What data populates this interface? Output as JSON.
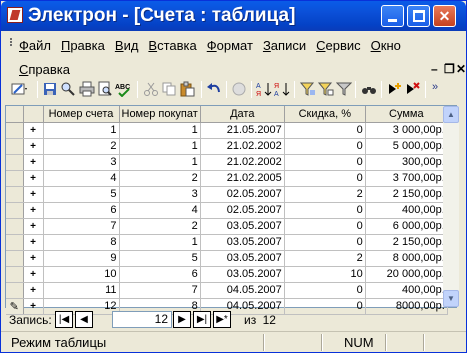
{
  "window": {
    "title": "Электрон - [Счета : таблица]"
  },
  "menu": {
    "items": [
      "Файл",
      "Правка",
      "Вид",
      "Вставка",
      "Формат",
      "Записи",
      "Сервис",
      "Окно"
    ],
    "help": "Справка"
  },
  "table": {
    "columns": [
      "Номер счета",
      "Номер покупат",
      "Дата",
      "Скидка, %",
      "Сумма"
    ],
    "rows": [
      [
        "1",
        "1",
        "21.05.2007",
        "0",
        "3 000,00р."
      ],
      [
        "2",
        "1",
        "21.02.2002",
        "0",
        "5 000,00р."
      ],
      [
        "3",
        "1",
        "21.02.2002",
        "0",
        "300,00р."
      ],
      [
        "4",
        "2",
        "21.02.2005",
        "0",
        "3 700,00р."
      ],
      [
        "5",
        "3",
        "02.05.2007",
        "2",
        "2 150,00р."
      ],
      [
        "6",
        "4",
        "02.05.2007",
        "0",
        "400,00р."
      ],
      [
        "7",
        "2",
        "03.05.2007",
        "0",
        "6 000,00р."
      ],
      [
        "8",
        "1",
        "03.05.2007",
        "0",
        "2 150,00р."
      ],
      [
        "9",
        "5",
        "03.05.2007",
        "2",
        "8 000,00р."
      ],
      [
        "10",
        "6",
        "03.05.2007",
        "10",
        "20 000,00р."
      ],
      [
        "11",
        "7",
        "04.05.2007",
        "0",
        "400,00р."
      ],
      [
        "12",
        "8",
        "04.05.2007",
        "0",
        "8000,00р."
      ]
    ],
    "row_marker": "+"
  },
  "navigator": {
    "label": "Запись:",
    "current": "12",
    "of_label": "из",
    "total": "12"
  },
  "status": {
    "mode": "Режим таблицы",
    "num": "NUM"
  }
}
